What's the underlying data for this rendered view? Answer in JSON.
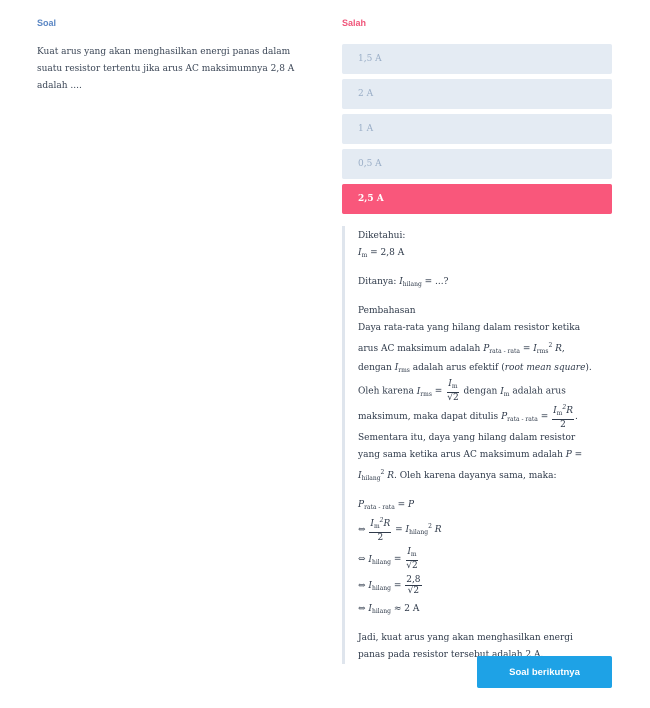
{
  "left": {
    "header": "Soal",
    "question": "Kuat arus yang akan menghasilkan energi panas dalam suatu resistor tertentu jika arus AC maksimumnya 2,8 A adalah ...."
  },
  "right": {
    "header": "Salah",
    "options": [
      "1,5 A",
      "2 A",
      "1 A",
      "0,5 A",
      "2,5 A"
    ],
    "selected_wrong_index": 4
  },
  "explanation": {
    "diketahui_label": "Diketahui:",
    "diketahui_value": "= 2,8 A",
    "ditanya_label": "Ditanya:",
    "ditanya_tail": "= ...?",
    "pembahasan_label": "Pembahasan",
    "text1": "Daya rata-rata yang hilang dalam resistor ketika arus AC maksimum adalah",
    "text2": ", dengan",
    "text3": "adalah arus efektif (",
    "text3_em": "root mean square",
    "text4": "). Oleh karena",
    "text5": "dengan",
    "text6": "adalah arus maksimum, maka dapat ditulis",
    "text7": ". Sementara itu, daya yang hilang dalam resistor yang sama ketika arus AC maksimum adalah",
    "text8": ". Oleh karena dayanya sama, maka:",
    "step_final": "≈ 2 A",
    "conclusion": "Jadi, kuat arus yang akan menghasilkan energi panas pada resistor tersebut adalah 2 A."
  },
  "button": {
    "next_label": "Soal berikutnya"
  },
  "colors": {
    "accent": "#1ea2e6",
    "wrong": "#f9577b",
    "option_bg": "#e4ebf3",
    "soal_header": "#5a86c4"
  }
}
